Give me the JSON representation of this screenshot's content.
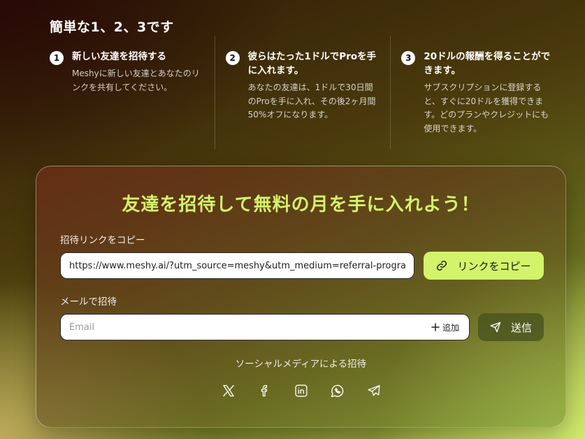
{
  "section_title": "簡単な1、2、3です",
  "steps": [
    {
      "num": "1",
      "title": "新しい友達を招待する",
      "desc": "Meshyに新しい友達とあなたのリンクを共有してください。"
    },
    {
      "num": "2",
      "title": "彼らはたった1ドルでProを手に入れます。",
      "desc": "あなたの友達は、1ドルで30日間のProを手に入れ、その後2ヶ月間50%オフになります。"
    },
    {
      "num": "3",
      "title": "20ドルの報酬を得ることができます。",
      "desc": "サブスクリプションに登録すると、すぐに20ドルを獲得できます。どのプランやクレジットにも使用できます。"
    }
  ],
  "card": {
    "heading": "友達を招待して無料の月を手に入れよう！",
    "copy_link_label": "招待リンクをコピー",
    "link_value": "https://www.meshy.ai/?utm_source=meshy&utm_medium=referral-program",
    "copy_button": "リンクをコピー",
    "email_label": "メールで招待",
    "email_placeholder": "Email",
    "add_button": "追加",
    "send_button": "送信",
    "social_label": "ソーシャルメディアによる招待",
    "socials": [
      "x-icon",
      "facebook-icon",
      "linkedin-icon",
      "whatsapp-icon",
      "telegram-icon"
    ]
  },
  "colors": {
    "accent": "#d3f36b",
    "send_button_bg": "#4a5420"
  }
}
